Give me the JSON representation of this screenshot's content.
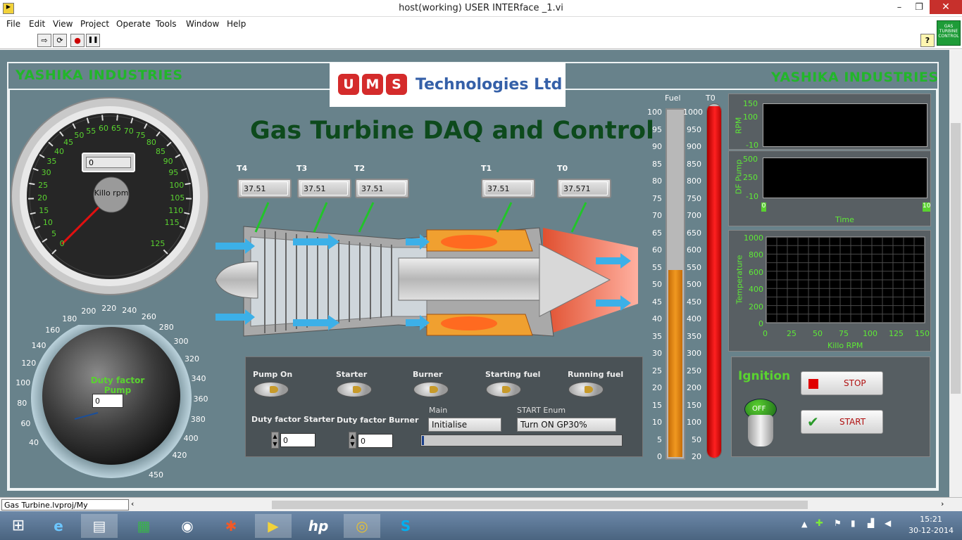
{
  "window": {
    "title": "host(working) USER INTERface _1.vi",
    "minimize": "–",
    "maximize": "❐",
    "close": "✕"
  },
  "menu": [
    "File",
    "Edit",
    "View",
    "Project",
    "Operate",
    "Tools",
    "Window",
    "Help"
  ],
  "toolbar": {
    "run": "⇨",
    "run_continuous": "⟳",
    "abort": "●",
    "pause": "❚❚",
    "help": "?"
  },
  "vi_icon": {
    "text": "GAS TURBINE CONTROL"
  },
  "brand": {
    "left": "YASHIKA INDUSTRIES",
    "right": "YASHIKA INDUSTRIES",
    "logo_letters": [
      "U",
      "M",
      "S"
    ],
    "logo_text": "Technologies Ltd"
  },
  "title": "Gas Turbine DAQ and Control",
  "rpm_gauge": {
    "value": "0",
    "label": "Killo rpm",
    "scale": [
      "0",
      "5",
      "10",
      "15",
      "20",
      "25",
      "30",
      "35",
      "40",
      "45",
      "50",
      "55",
      "60",
      "65",
      "70",
      "75",
      "80",
      "85",
      "90",
      "95",
      "100",
      "105",
      "110",
      "115",
      "125"
    ],
    "needle_value": 0
  },
  "pump_knob": {
    "label": "Duty factor Pump",
    "value": "0",
    "scale": [
      "40",
      "60",
      "80",
      "100",
      "120",
      "140",
      "160",
      "180",
      "200",
      "220",
      "240",
      "260",
      "280",
      "300",
      "320",
      "340",
      "360",
      "380",
      "400",
      "420",
      "450"
    ],
    "needle_value": 40
  },
  "temps": [
    {
      "label": "T4",
      "value": "37.51"
    },
    {
      "label": "T3",
      "value": "37.51"
    },
    {
      "label": "T2",
      "value": "37.51"
    },
    {
      "label": "T1",
      "value": "37.51"
    },
    {
      "label": "T0",
      "value": "37.571"
    }
  ],
  "controls": {
    "leds": [
      "Pump On",
      "Starter",
      "Burner",
      "Starting fuel",
      "Running fuel"
    ],
    "duty_starter_label": "Duty factor Starter",
    "duty_starter_value": "0",
    "duty_burner_label": "Duty factor Burner",
    "duty_burner_value": "0",
    "main_label": "Main",
    "main_value": "Initialise",
    "start_enum_label": "START Enum",
    "start_enum_value": "Turn ON GP30%",
    "progress": 0.01
  },
  "fuel_tank": {
    "label": "Fuel",
    "scale": [
      "100",
      "95",
      "90",
      "85",
      "80",
      "75",
      "70",
      "65",
      "60",
      "55",
      "50",
      "45",
      "40",
      "35",
      "30",
      "25",
      "20",
      "15",
      "10",
      "5",
      "0"
    ],
    "level": 54
  },
  "t0_thermo": {
    "label": "T0",
    "scale": [
      "1000",
      "950",
      "900",
      "850",
      "800",
      "750",
      "700",
      "650",
      "600",
      "550",
      "500",
      "450",
      "400",
      "350",
      "300",
      "250",
      "200",
      "150",
      "100",
      "50",
      "20"
    ],
    "level": 1000
  },
  "rpm_chart": {
    "ylabel": "RPM",
    "ticks": [
      "150",
      "100",
      "-10"
    ]
  },
  "df_chart": {
    "ylabel": "DF Pump",
    "ticks": [
      "500",
      "250",
      "-10"
    ],
    "xlabel": "Time",
    "xmin": "0",
    "xmax": "10"
  },
  "temp_graph": {
    "ylabel": "Temperature",
    "xlabel": "Killo RPM",
    "yticks": [
      "1000",
      "800",
      "600",
      "400",
      "200",
      "0"
    ],
    "xticks": [
      "0",
      "25",
      "50",
      "75",
      "100",
      "125",
      "150"
    ]
  },
  "ignition": {
    "label": "Ignition",
    "switch_state": "OFF",
    "stop": "STOP",
    "start": "START"
  },
  "statusbar": {
    "project": "Gas Turbine.lvproj/My Computer"
  },
  "taskbar": {
    "time": "15:21",
    "date": "30-12-2014"
  }
}
